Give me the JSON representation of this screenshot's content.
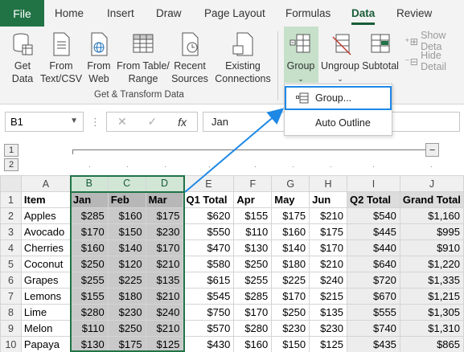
{
  "tabs": [
    {
      "label": "File"
    },
    {
      "label": "Home"
    },
    {
      "label": "Insert"
    },
    {
      "label": "Draw"
    },
    {
      "label": "Page Layout"
    },
    {
      "label": "Formulas"
    },
    {
      "label": "Data"
    },
    {
      "label": "Review"
    }
  ],
  "ribbon": {
    "get_data": "Get\nData",
    "from_text": "From\nText/CSV",
    "from_web": "From\nWeb",
    "from_table": "From Table/\nRange",
    "recent_sources": "Recent\nSources",
    "existing_connections": "Existing\nConnections",
    "group": "Group",
    "ungroup": "Ungroup",
    "subtotal": "Subtotal",
    "show_detail": "Show Deta",
    "hide_detail": "Hide Detail",
    "group_label": "Get & Transform Data"
  },
  "dropdown": {
    "group_item": "Group...",
    "auto_outline": "Auto Outline"
  },
  "formula_bar": {
    "name_box": "B1",
    "fx": "fx",
    "content": "Jan"
  },
  "outline_levels": [
    "1",
    "2"
  ],
  "outline_collapse": "−",
  "columns": [
    "A",
    "B",
    "C",
    "D",
    "E",
    "F",
    "G",
    "H",
    "I",
    "J"
  ],
  "headers": [
    "Item",
    "Jan",
    "Feb",
    "Mar",
    "Q1 Total",
    "Apr",
    "May",
    "Jun",
    "Q2 Total",
    "Grand Total"
  ],
  "rows": [
    {
      "n": "2",
      "cells": [
        "Apples",
        "$285",
        "$160",
        "$175",
        "$620",
        "$155",
        "$175",
        "$210",
        "$540",
        "$1,160"
      ]
    },
    {
      "n": "3",
      "cells": [
        "Avocado",
        "$170",
        "$150",
        "$230",
        "$550",
        "$110",
        "$160",
        "$175",
        "$445",
        "$995"
      ]
    },
    {
      "n": "4",
      "cells": [
        "Cherries",
        "$160",
        "$140",
        "$170",
        "$470",
        "$130",
        "$140",
        "$170",
        "$440",
        "$910"
      ]
    },
    {
      "n": "5",
      "cells": [
        "Coconut",
        "$250",
        "$120",
        "$210",
        "$580",
        "$250",
        "$180",
        "$210",
        "$640",
        "$1,220"
      ]
    },
    {
      "n": "6",
      "cells": [
        "Grapes",
        "$255",
        "$225",
        "$135",
        "$615",
        "$255",
        "$225",
        "$240",
        "$720",
        "$1,335"
      ]
    },
    {
      "n": "7",
      "cells": [
        "Lemons",
        "$155",
        "$180",
        "$210",
        "$545",
        "$285",
        "$170",
        "$215",
        "$670",
        "$1,215"
      ]
    },
    {
      "n": "8",
      "cells": [
        "Lime",
        "$280",
        "$230",
        "$240",
        "$750",
        "$170",
        "$250",
        "$135",
        "$555",
        "$1,305"
      ]
    },
    {
      "n": "9",
      "cells": [
        "Melon",
        "$110",
        "$250",
        "$210",
        "$570",
        "$280",
        "$230",
        "$230",
        "$740",
        "$1,310"
      ]
    },
    {
      "n": "10",
      "cells": [
        "Papaya",
        "$130",
        "$175",
        "$125",
        "$430",
        "$160",
        "$150",
        "$125",
        "$435",
        "$865"
      ]
    }
  ],
  "colors": {
    "excel_green": "#217346",
    "arrow_blue": "#1e88e5"
  }
}
